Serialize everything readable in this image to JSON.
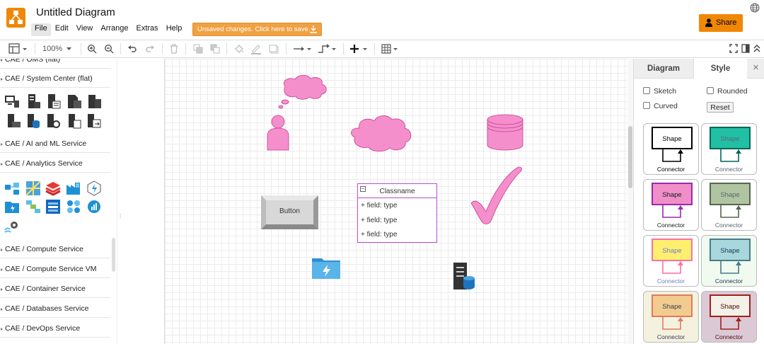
{
  "header": {
    "title": "Untitled Diagram",
    "menu": [
      "File",
      "Edit",
      "View",
      "Arrange",
      "Extras",
      "Help"
    ],
    "unsaved": "Unsaved changes. Click here to save.",
    "share": "Share",
    "colors": {
      "brand": "#f08705",
      "unsaved": "#f0a142"
    }
  },
  "toolbar": {
    "zoom": "100%"
  },
  "sidebar": {
    "sections": [
      "CAE / OMS (flat)",
      "CAE / System Center (flat)",
      "CAE / AI and ML Service",
      "CAE / Analytics Service",
      "CAE / Compute Service",
      "CAE / Compute Service VM",
      "CAE / Container Service",
      "CAE / Databases Service",
      "CAE / DevOps Service"
    ]
  },
  "canvas": {
    "button_label": "Button",
    "class_title": "Classname",
    "fields": [
      "+ field: type",
      "+ field: type",
      "+ field: type"
    ],
    "shape_color": "#f48fcc"
  },
  "format_panel": {
    "tabs": [
      "Diagram",
      "Style"
    ],
    "close": "×",
    "options": [
      "Sketch",
      "Rounded",
      "Curved"
    ],
    "reset": "Reset",
    "styles": [
      {
        "shape": "Shape",
        "connector": "Connector",
        "fill": "#ffffff",
        "stroke": "#000000",
        "text": "#000000",
        "bg": "#ffffff"
      },
      {
        "shape": "Shape",
        "connector": "Connector",
        "fill": "#21c0a5",
        "stroke": "#006658",
        "text": "#5c6670",
        "bg": "#ffffff"
      },
      {
        "shape": "Shape",
        "connector": "Connector",
        "fill": "#f08ec8",
        "stroke": "#9c27b0",
        "text": "#1a1a1a",
        "bg": "#ffffff"
      },
      {
        "shape": "Shape",
        "connector": "Connector",
        "fill": "#b0c4a1",
        "stroke": "#55674b",
        "text": "#5c6670",
        "bg": "#ffffff"
      },
      {
        "shape": "Shape",
        "connector": "Connector",
        "fill": "#ffef6f",
        "stroke": "#ff6fa1",
        "text": "#6a7ec9",
        "bg": "#ffffff"
      },
      {
        "shape": "Shape",
        "connector": "Connector",
        "fill": "#a8d8dc",
        "stroke": "#457b8d",
        "text": "#1d3557",
        "bg": "#f1faee"
      },
      {
        "shape": "Shape",
        "connector": "Connector",
        "fill": "#f2cc8f",
        "stroke": "#e07a5f",
        "text": "#393c56",
        "bg": "#f4f1de"
      },
      {
        "shape": "Shape",
        "connector": "Connector",
        "fill": "#f2f0e7",
        "stroke": "#a0201c",
        "text": "#4d0f0c",
        "bg": "#dbc9d6"
      }
    ]
  }
}
